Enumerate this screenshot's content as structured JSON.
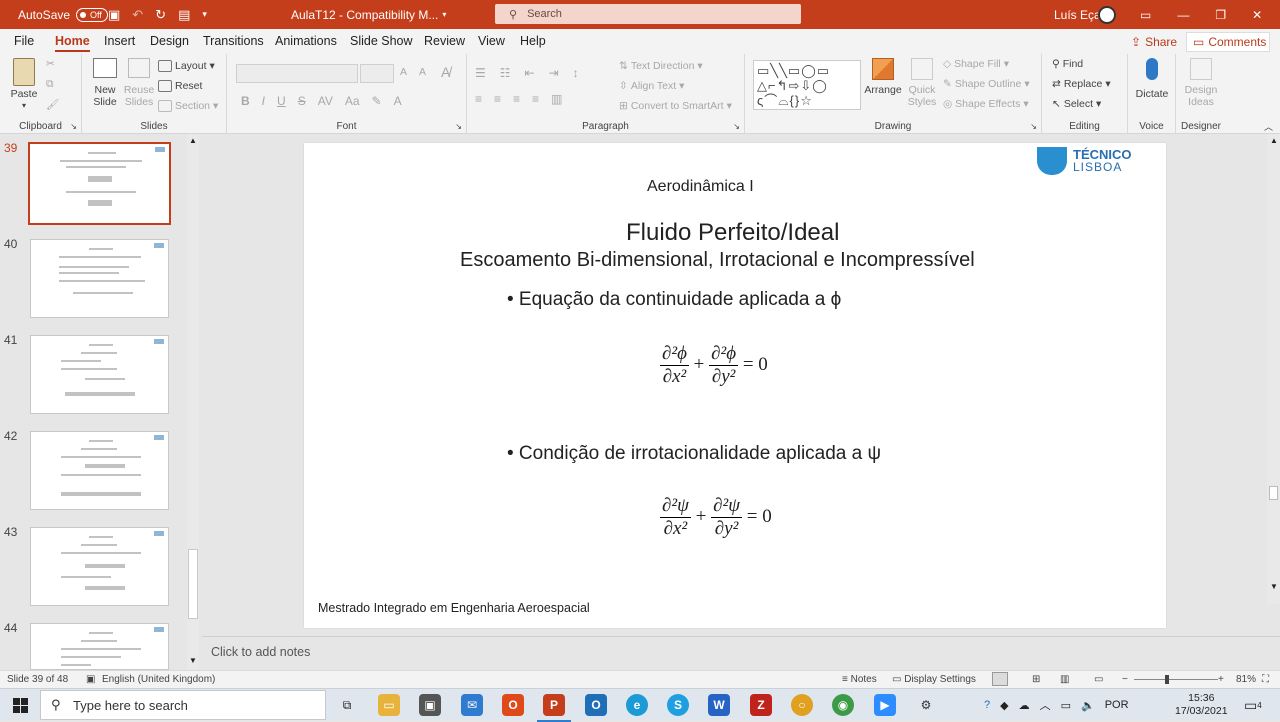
{
  "titlebar": {
    "autosave_label": "AutoSave",
    "autosave_state": "Off",
    "doc_title": "AulaT12 - Compatibility M...",
    "search_placeholder": "Search",
    "user_name": "Luís Eça",
    "accent_color": "#c43e1c"
  },
  "menu": {
    "tabs": [
      "File",
      "Home",
      "Insert",
      "Design",
      "Transitions",
      "Animations",
      "Slide Show",
      "Review",
      "View",
      "Help"
    ],
    "active_tab": "Home",
    "share_label": "Share",
    "comments_label": "Comments"
  },
  "ribbon": {
    "clipboard": {
      "paste": "Paste",
      "label": "Clipboard"
    },
    "slides": {
      "new_slide": "New Slide",
      "reuse_slides": "Reuse Slides",
      "layout": "Layout",
      "reset": "Reset",
      "section": "Section",
      "label": "Slides"
    },
    "font": {
      "bold": "B",
      "italic": "I",
      "underline": "U",
      "strike": "S",
      "spacing": "AV",
      "case": "Aa",
      "label": "Font"
    },
    "paragraph": {
      "text_direction": "Text Direction",
      "align_text": "Align Text",
      "convert_smartart": "Convert to SmartArt",
      "label": "Paragraph"
    },
    "drawing": {
      "arrange": "Arrange",
      "quick_styles": "Quick Styles",
      "shape_fill": "Shape Fill",
      "shape_outline": "Shape Outline",
      "shape_effects": "Shape Effects",
      "label": "Drawing"
    },
    "editing": {
      "find": "Find",
      "replace": "Replace",
      "select": "Select",
      "label": "Editing"
    },
    "voice": {
      "dictate": "Dictate",
      "label": "Voice"
    },
    "designer": {
      "design_ideas": "Design Ideas",
      "label": "Designer"
    }
  },
  "thumbnails": [
    {
      "number": "39",
      "selected": true
    },
    {
      "number": "40",
      "selected": false
    },
    {
      "number": "41",
      "selected": false
    },
    {
      "number": "42",
      "selected": false
    },
    {
      "number": "43",
      "selected": false
    },
    {
      "number": "44",
      "selected": false
    }
  ],
  "slide": {
    "course": "Aerodinâmica I",
    "logo_line1": "TÉCNICO",
    "logo_line2": "LISBOA",
    "title": "Fluido Perfeito/Ideal",
    "subtitle": "Escoamento Bi-dimensional, Irrotacional e Incompressível",
    "bullet1": "• Equação da continuidade aplicada a ϕ",
    "bullet2": "• Condição de irrotacionalidade aplicada a ψ",
    "eq1": {
      "num1": "∂²ϕ",
      "den1": "∂x²",
      "num2": "∂²ϕ",
      "den2": "∂y²",
      "plus": "+",
      "rhs": "= 0"
    },
    "eq2": {
      "num1": "∂²ψ",
      "den1": "∂x²",
      "num2": "∂²ψ",
      "den2": "∂y²",
      "plus": "+",
      "rhs": "= 0"
    },
    "footer": "Mestrado Integrado em Engenharia Aeroespacial"
  },
  "notes_placeholder": "Click to add notes",
  "status": {
    "slide_count": "Slide 39 of 48",
    "language": "English (United Kingdom)",
    "notes_btn": "Notes",
    "display_settings": "Display Settings",
    "zoom": "81%",
    "zoom_level": 0.81
  },
  "taskbar": {
    "search_placeholder": "Type here to search",
    "language": "POR",
    "time": "15:36",
    "date": "17/03/2021",
    "notification_count": "4"
  }
}
